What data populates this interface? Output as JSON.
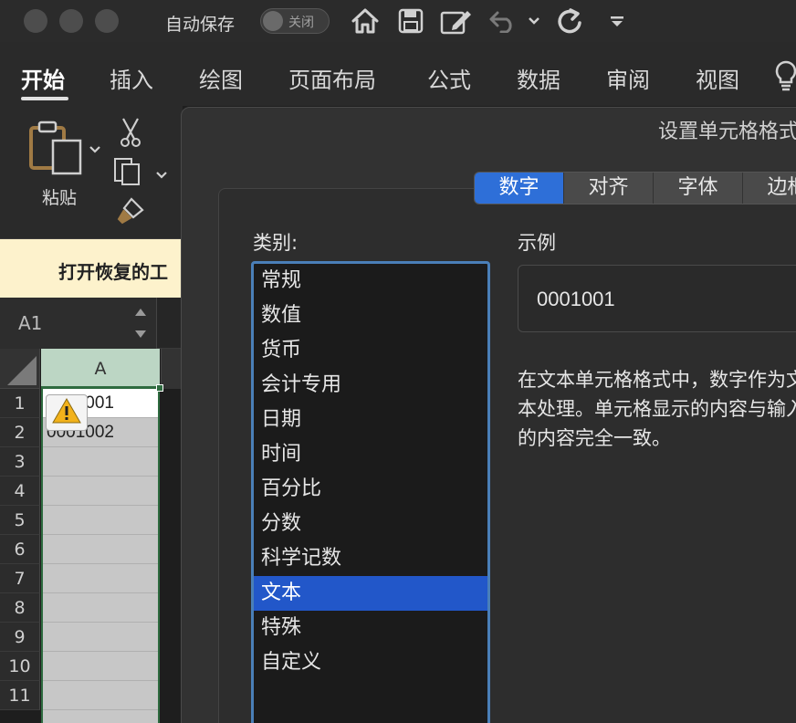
{
  "titlebar": {
    "autosave_label": "自动保存",
    "autosave_state": "关闭",
    "icons": [
      "home-icon",
      "save-icon",
      "edit-icon",
      "undo-icon",
      "chevron-down-icon",
      "redo-icon",
      "customize-icon"
    ]
  },
  "ribbon_tabs": [
    {
      "label": "开始",
      "active": true
    },
    {
      "label": "插入"
    },
    {
      "label": "绘图"
    },
    {
      "label": "页面布局"
    },
    {
      "label": "公式"
    },
    {
      "label": "数据"
    },
    {
      "label": "审阅"
    },
    {
      "label": "视图"
    }
  ],
  "ribbon": {
    "paste_label": "粘贴"
  },
  "message_bar": {
    "text": "打开恢复的工"
  },
  "name_box": {
    "value": "A1"
  },
  "sheet": {
    "column_header": "A",
    "rows": [
      "1",
      "2",
      "3",
      "4",
      "5",
      "6",
      "7",
      "8",
      "9",
      "10",
      "11"
    ],
    "cells": {
      "a1": "0001001",
      "a2": "0001002"
    }
  },
  "dialog": {
    "title": "设置单元格格式",
    "tabs": [
      "数字",
      "对齐",
      "字体",
      "边框"
    ],
    "active_tab": "数字",
    "category_label": "类别:",
    "categories": [
      "常规",
      "数值",
      "货币",
      "会计专用",
      "日期",
      "时间",
      "百分比",
      "分数",
      "科学记数",
      "文本",
      "特殊",
      "自定义"
    ],
    "selected_category": "文本",
    "sample_label": "示例",
    "sample_value": "0001001",
    "description": "在文本单元格格式中，数字作为文本处理。单元格显示的内容与输入的内容完全一致。"
  },
  "colors": {
    "accent": "#2e6fd8",
    "selection": "#2257c9",
    "sheet_selected_header": "#bcd6c4",
    "warning_bar": "#fdf2cc"
  }
}
